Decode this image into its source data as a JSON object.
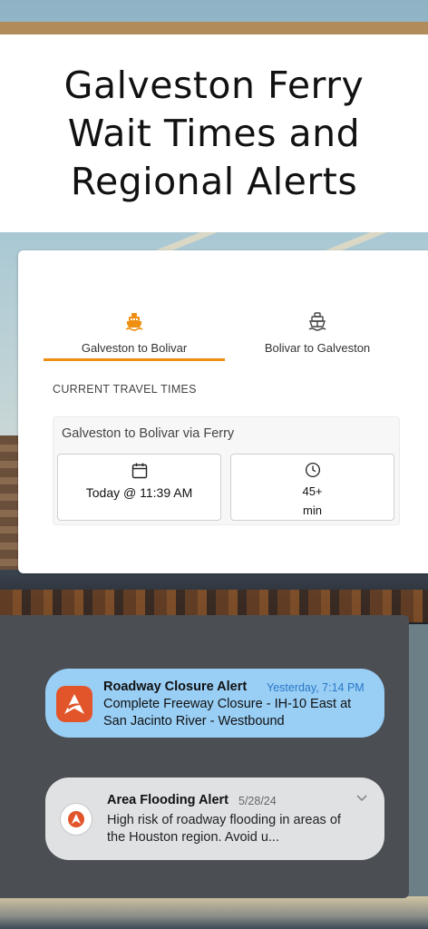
{
  "header": {
    "title": "Galveston Ferry Wait Times and Regional Alerts"
  },
  "tabs": [
    {
      "label": "Galveston to Bolivar",
      "active": true,
      "icon": "ferry-filled-icon"
    },
    {
      "label": "Bolivar to Galveston",
      "active": false,
      "icon": "ship-outline-icon"
    }
  ],
  "section": {
    "label": "CURRENT TRAVEL TIMES"
  },
  "route": {
    "title": "Galveston to Bolivar via Ferry",
    "time": "Today @ 11:39 AM",
    "wait_value": "45+",
    "wait_unit": "min"
  },
  "notifications": [
    {
      "title": "Roadway Closure Alert",
      "time": "Yesterday, 7:14 PM",
      "body": "Complete Freeway Closure - IH-10 East at San Jacinto River - Westbound"
    },
    {
      "title": "Area Flooding Alert",
      "time": "5/28/24",
      "body": "High risk of roadway flooding in areas of the Houston region. Avoid u..."
    }
  ],
  "colors": {
    "accent": "#ef8f12",
    "notification_highlight": "#99cef5",
    "app_icon": "#e2552b",
    "timestamp_blue": "#2a79c7"
  }
}
